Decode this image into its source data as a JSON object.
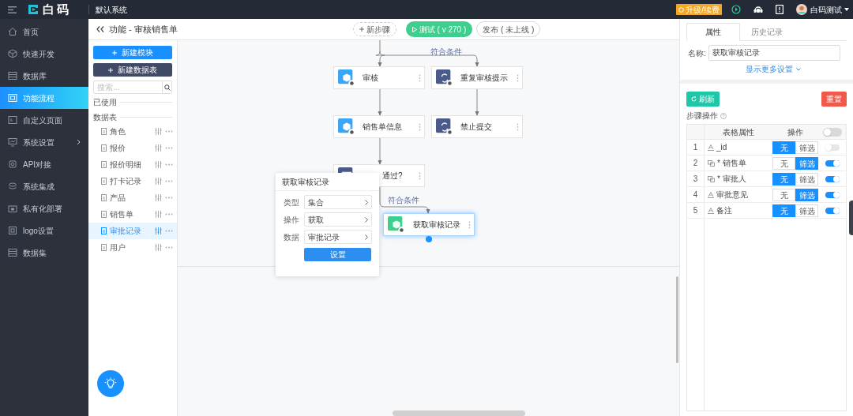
{
  "topbar": {
    "logo_text": "白码",
    "system": "默认系统",
    "upgrade": "升级/续费",
    "user": "白码测试"
  },
  "nav": [
    {
      "label": "首页",
      "selected": false,
      "expandable": false
    },
    {
      "label": "快速开发",
      "selected": false,
      "expandable": false
    },
    {
      "label": "数据库",
      "selected": false,
      "expandable": false
    },
    {
      "label": "功能流程",
      "selected": true,
      "expandable": false
    },
    {
      "label": "自定义页面",
      "selected": false,
      "expandable": false
    },
    {
      "label": "系统设置",
      "selected": false,
      "expandable": true
    },
    {
      "label": "API对接",
      "selected": false,
      "expandable": false
    },
    {
      "label": "系统集成",
      "selected": false,
      "expandable": false
    },
    {
      "label": "私有化部署",
      "selected": false,
      "expandable": false
    },
    {
      "label": "logo设置",
      "selected": false,
      "expandable": false
    },
    {
      "label": "数据集",
      "selected": false,
      "expandable": false
    }
  ],
  "header": {
    "title": "功能 - 审核销售单",
    "new_step": "新步骤",
    "test": "测试 ( v 270 )",
    "publish": "发布 ( 未上线 )"
  },
  "modules": {
    "new_module": "新建模块",
    "new_table": "新建数据表",
    "search_placeholder": "搜索...",
    "used_label": "已使用",
    "tables_label": "数据表",
    "items": [
      {
        "label": "角色",
        "selected": false
      },
      {
        "label": "报价",
        "selected": false
      },
      {
        "label": "报价明细",
        "selected": false
      },
      {
        "label": "打卡记录",
        "selected": false
      },
      {
        "label": "产品",
        "selected": false
      },
      {
        "label": "销售单",
        "selected": false
      },
      {
        "label": "审批记录",
        "selected": true
      },
      {
        "label": "用户",
        "selected": false
      }
    ]
  },
  "flow": {
    "edge_labels": [
      "符合条件",
      "符合条件"
    ],
    "nodes": [
      {
        "label": "审核",
        "kind": "module",
        "selected": false
      },
      {
        "label": "重复审核提示",
        "kind": "logic",
        "selected": false
      },
      {
        "label": "销售单信息",
        "kind": "module",
        "selected": false
      },
      {
        "label": "禁止提交",
        "kind": "logic",
        "selected": false
      },
      {
        "label": "通过?",
        "kind": "condition",
        "selected": false
      },
      {
        "label": "获取审核记录",
        "kind": "data",
        "selected": true
      }
    ]
  },
  "popup": {
    "title": "获取审核记录",
    "fields": [
      {
        "label": "类型",
        "value": "集合"
      },
      {
        "label": "操作",
        "value": "获取"
      },
      {
        "label": "数据",
        "value": "审批记录"
      }
    ],
    "button": "设置"
  },
  "panel": {
    "tabs": [
      {
        "label": "属性",
        "selected": true
      },
      {
        "label": "历史记录",
        "selected": false
      }
    ],
    "name_label": "名称:",
    "name_value": "获取审核记录",
    "more": "显示更多设置",
    "refresh": "刷新",
    "reset": "重置",
    "section": "步骤操作",
    "columns": [
      "表格属性",
      "操作"
    ],
    "header_toggle_on": false,
    "rows": [
      {
        "index": "1",
        "kind": "text",
        "name": "_id",
        "options": [
          {
            "label": "无",
            "selected": true
          },
          {
            "label": "筛选",
            "selected": false
          }
        ],
        "on": false
      },
      {
        "index": "2",
        "kind": "link",
        "name": "* 销售单",
        "options": [
          {
            "label": "无",
            "selected": false
          },
          {
            "label": "筛选",
            "selected": true
          }
        ],
        "on": true
      },
      {
        "index": "3",
        "kind": "link",
        "name": "* 审批人",
        "options": [
          {
            "label": "无",
            "selected": true
          },
          {
            "label": "筛选",
            "selected": false
          }
        ],
        "on": true
      },
      {
        "index": "4",
        "kind": "text",
        "name": "审批意见",
        "options": [
          {
            "label": "无",
            "selected": false
          },
          {
            "label": "筛选",
            "selected": true
          }
        ],
        "on": true
      },
      {
        "index": "5",
        "kind": "text",
        "name": "备注",
        "options": [
          {
            "label": "无",
            "selected": true
          },
          {
            "label": "筛选",
            "selected": false
          }
        ],
        "on": true
      }
    ]
  }
}
